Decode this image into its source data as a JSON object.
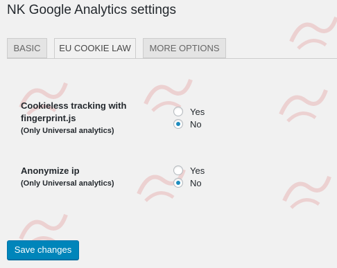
{
  "page": {
    "title": "NK Google Analytics settings"
  },
  "tabs": [
    {
      "label": "BASIC",
      "active": false
    },
    {
      "label": "EU COOKIE LAW",
      "active": true
    },
    {
      "label": "MORE OPTIONS",
      "active": false
    }
  ],
  "settings": [
    {
      "title_line1": "Cookieless tracking with",
      "title_line2": "fingerprint.js",
      "note": "(Only Universal analytics)",
      "options": [
        {
          "label": "Yes",
          "checked": false
        },
        {
          "label": "No",
          "checked": true
        }
      ]
    },
    {
      "title_line1": "Anonymize ip",
      "note": "(Only Universal analytics)",
      "options": [
        {
          "label": "Yes",
          "checked": false
        },
        {
          "label": "No",
          "checked": true
        }
      ]
    }
  ],
  "actions": {
    "save_label": "Save changes"
  },
  "colors": {
    "accent": "#0085ba",
    "radio_dot": "#1e8cbe",
    "background": "#f1f1f1",
    "watermark": "#d32f2f"
  },
  "icons": {
    "watermark": "logo-watermark-icon"
  }
}
